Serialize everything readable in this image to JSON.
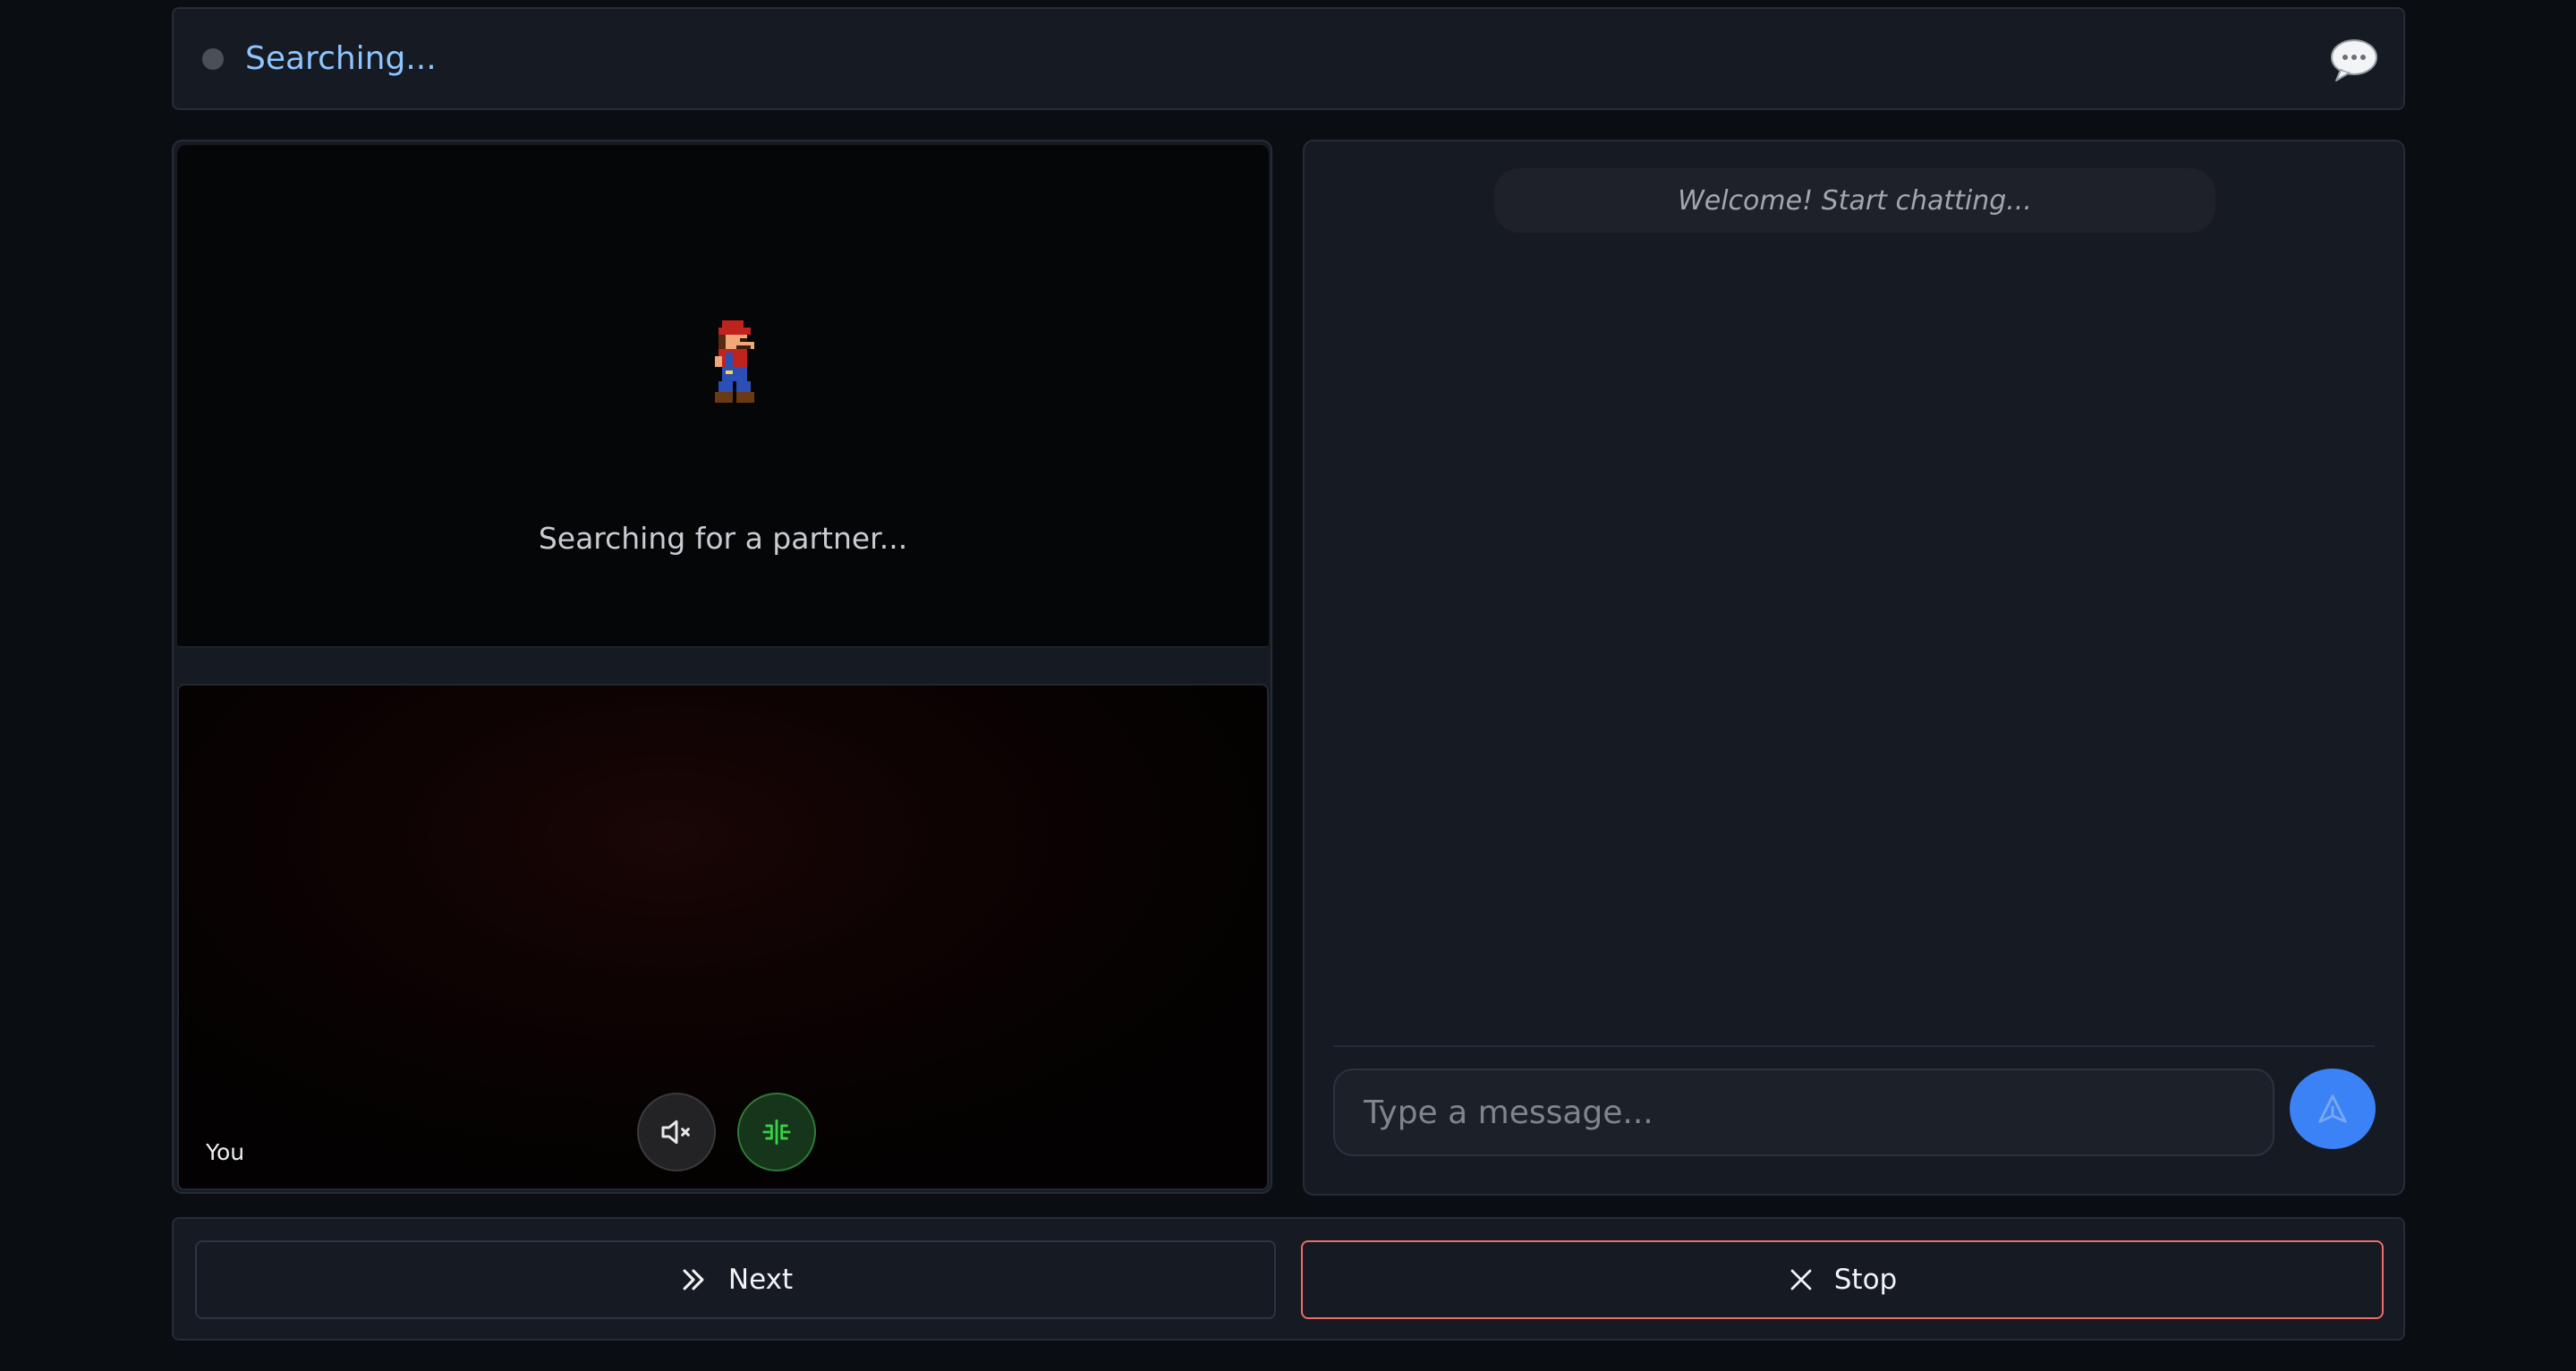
{
  "status": {
    "text": "Searching...",
    "dot_color": "#4b4f57",
    "chat_toggle_icon": "speech-bubble-icon"
  },
  "remote": {
    "status_text": "Searching for a partner...",
    "avatar_icon": "pixel-mario-sprite"
  },
  "local": {
    "label": "You",
    "mute_icon": "speaker-muted-icon",
    "camera_icon": "camera-switch-icon"
  },
  "chat": {
    "welcome": "Welcome! Start chatting...",
    "input_placeholder": "Type a message...",
    "input_value": "",
    "send_icon": "send-arrow-icon"
  },
  "actions": {
    "next_label": "Next",
    "next_icon": "double-chevron-right-icon",
    "stop_label": "Stop",
    "stop_icon": "close-icon",
    "stop_border_color": "#f06b6b"
  },
  "colors": {
    "accent": "#3b82f6",
    "status_text": "#8ec5ff",
    "camera_active": "#39d04a"
  }
}
